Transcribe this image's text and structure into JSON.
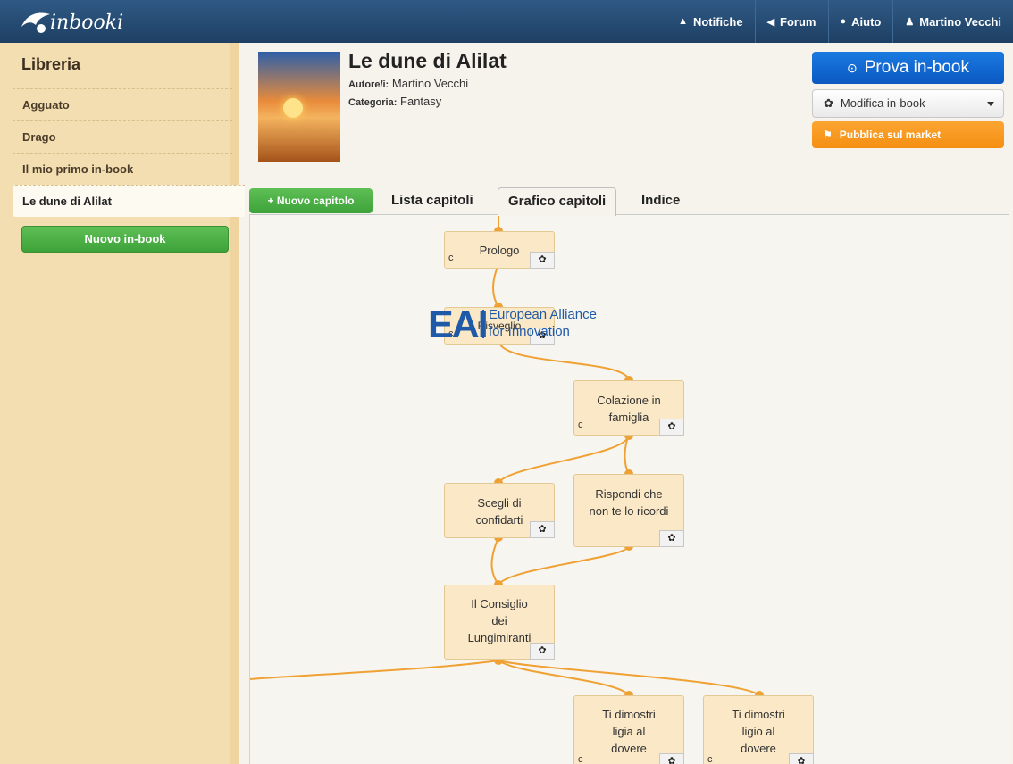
{
  "app": {
    "logo_text": "inbooki"
  },
  "nav": {
    "notifiche": "Notifiche",
    "forum": "Forum",
    "aiuto": "Aiuto",
    "user": "Martino Vecchi"
  },
  "sidebar": {
    "title": "Libreria",
    "items": [
      {
        "label": "Agguato"
      },
      {
        "label": "Drago"
      },
      {
        "label": "Il mio primo in-book"
      },
      {
        "label": "Le dune di Alilat"
      }
    ],
    "new_button": "Nuovo in-book"
  },
  "book": {
    "title": "Le dune di Alilat",
    "author_label": "Autore/i:",
    "author": "Martino Vecchi",
    "category_label": "Categoria:",
    "category": "Fantasy"
  },
  "actions": {
    "prova": "Prova in-book",
    "modifica": "Modifica in-book",
    "pubblica": "Pubblica sul market"
  },
  "tabs": {
    "nuovo_capitolo": "+ Nuovo capitolo",
    "lista": "Lista capitoli",
    "grafico": "Grafico capitoli",
    "indice": "Indice"
  },
  "watermark": {
    "big": "EAI",
    "line1": "European Alliance",
    "line2": "for Innovation"
  },
  "chapters": [
    {
      "id": "prologo",
      "title": "Prologo",
      "flag": "c"
    },
    {
      "id": "risveglio",
      "title": "Risveglio",
      "flag": "c"
    },
    {
      "id": "colazione",
      "title": "Colazione in famiglia",
      "flag": "c"
    },
    {
      "id": "scegli",
      "title": "Scegli di confidarti",
      "flag": ""
    },
    {
      "id": "rispondi",
      "title": "Rispondi che non te lo ricordi",
      "flag": ""
    },
    {
      "id": "consiglio",
      "title": "Il Consiglio dei Lungimiranti",
      "flag": ""
    },
    {
      "id": "ligia",
      "title": "Ti dimostri ligia al dovere",
      "flag": "c"
    },
    {
      "id": "ligio",
      "title": "Ti dimostri ligio al dovere",
      "flag": "c"
    }
  ],
  "icons": {
    "gear": "gear-icon"
  }
}
